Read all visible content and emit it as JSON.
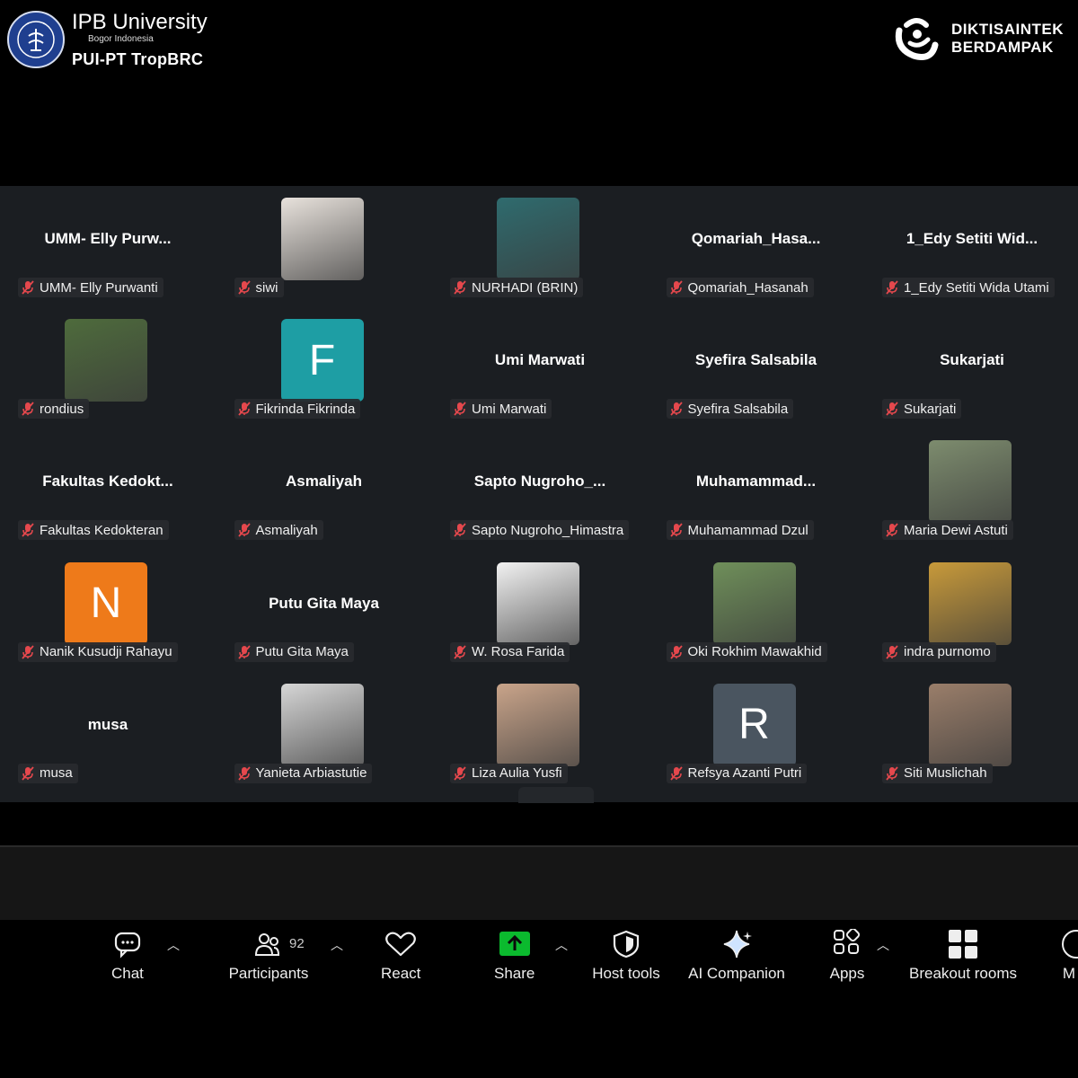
{
  "branding": {
    "institution": "IPB University",
    "institution_sub": "Bogor Indonesia",
    "unit": "PUI-PT TropBRC",
    "partner_line1": "DIKTISAINTEK",
    "partner_line2": "BERDAMPAK"
  },
  "participants": [
    {
      "title": "UMM- Elly Purw...",
      "name": "UMM- Elly Purwanti",
      "type": "name"
    },
    {
      "title": "",
      "name": "siwi",
      "type": "photo",
      "color": "#e8e2dc"
    },
    {
      "title": "",
      "name": "NURHADI (BRIN)",
      "type": "photo",
      "color": "#2f6b6e"
    },
    {
      "title": "Qomariah_Hasa...",
      "name": "Qomariah_Hasanah",
      "type": "name"
    },
    {
      "title": "1_Edy Setiti Wid...",
      "name": "1_Edy Setiti Wida Utami",
      "type": "name"
    },
    {
      "title": "",
      "name": "rondius",
      "type": "photo",
      "color": "#4e6b3c"
    },
    {
      "title": "",
      "name": "Fikrinda Fikrinda",
      "type": "letter",
      "letter": "F",
      "color": "#1e9ea4"
    },
    {
      "title": "Umi Marwati",
      "name": "Umi Marwati",
      "type": "name"
    },
    {
      "title": "Syefira Salsabila",
      "name": "Syefira Salsabila",
      "type": "name"
    },
    {
      "title": "Sukarjati",
      "name": "Sukarjati",
      "type": "name"
    },
    {
      "title": "Fakultas Kedokt...",
      "name": "Fakultas Kedokteran",
      "type": "name"
    },
    {
      "title": "Asmaliyah",
      "name": "Asmaliyah",
      "type": "name"
    },
    {
      "title": "Sapto Nugroho_...",
      "name": "Sapto Nugroho_Himastra",
      "type": "name"
    },
    {
      "title": "Muhamammad...",
      "name": "Muhamammad Dzul",
      "type": "name"
    },
    {
      "title": "",
      "name": "Maria Dewi Astuti",
      "type": "photo",
      "color": "#7d8c6e"
    },
    {
      "title": "",
      "name": "Nanik Kusudji Rahayu",
      "type": "letter",
      "letter": "N",
      "color": "#ee7a1a"
    },
    {
      "title": "Putu Gita Maya",
      "name": "Putu Gita Maya",
      "type": "name"
    },
    {
      "title": "",
      "name": "W. Rosa Farida",
      "type": "photo",
      "color": "#f2f2f2"
    },
    {
      "title": "",
      "name": "Oki Rokhim Mawakhid",
      "type": "photo",
      "color": "#6f8f5a"
    },
    {
      "title": "",
      "name": "indra purnomo",
      "type": "photo",
      "color": "#c89a3a"
    },
    {
      "title": "musa",
      "name": "musa",
      "type": "name"
    },
    {
      "title": "",
      "name": "Yanieta Arbiastutie",
      "type": "photo",
      "color": "#d6d6d6"
    },
    {
      "title": "",
      "name": "Liza Aulia Yusfi",
      "type": "photo",
      "color": "#c9a48a"
    },
    {
      "title": "",
      "name": "Refsya Azanti Putri",
      "type": "letter",
      "letter": "R",
      "color": "#4a5560"
    },
    {
      "title": "",
      "name": "Siti Muslichah",
      "type": "photo",
      "color": "#9a7e6a"
    }
  ],
  "toolbar": {
    "chat": "Chat",
    "participants": "Participants",
    "participants_count": "92",
    "react": "React",
    "share": "Share",
    "host_tools": "Host tools",
    "ai_companion": "AI Companion",
    "apps": "Apps",
    "breakout_rooms": "Breakout rooms",
    "more": "M"
  },
  "colors": {
    "gallery_bg": "#1b1e22",
    "share_green": "#0bba2e",
    "mic_red": "#e5484d"
  }
}
